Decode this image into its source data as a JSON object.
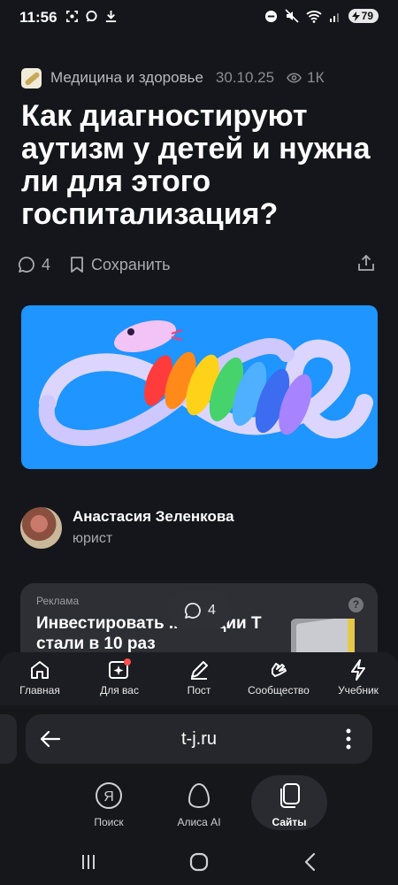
{
  "status_bar": {
    "time": "11:56",
    "battery": "79"
  },
  "article": {
    "category": "Медицина и здоровье",
    "date": "30.10.25",
    "views": "1К",
    "title": "Как диагностируют аутизм у детей и нужна ли для этого госпитализация?",
    "comments_count": "4",
    "save_label": "Сохранить"
  },
  "author": {
    "name": "Анастасия Зеленкова",
    "role": "юрист"
  },
  "ad": {
    "label": "Реклама",
    "title": "Инвестировать ... : акции Т стали в 10 раз"
  },
  "floating_comments": {
    "count": "4"
  },
  "tab_bar": {
    "items": [
      {
        "label": "Главная",
        "icon": "home-icon"
      },
      {
        "label": "Для вас",
        "icon": "sparkle-icon"
      },
      {
        "label": "Пост",
        "icon": "pencil-icon"
      },
      {
        "label": "Сообщество",
        "icon": "hands-icon"
      },
      {
        "label": "Учебник",
        "icon": "bolt-icon"
      }
    ]
  },
  "browser": {
    "url": "t-j.ru",
    "tabs": [
      {
        "label": "Поиск",
        "icon": "yandex-icon"
      },
      {
        "label": "Алиса AI",
        "icon": "alice-icon"
      },
      {
        "label": "Сайты",
        "icon": "pages-icon",
        "active": true
      }
    ]
  },
  "colors": {
    "background": "#15161b",
    "hero_blue": "#1e95ff",
    "badge_dot": "#ff4f4f"
  }
}
